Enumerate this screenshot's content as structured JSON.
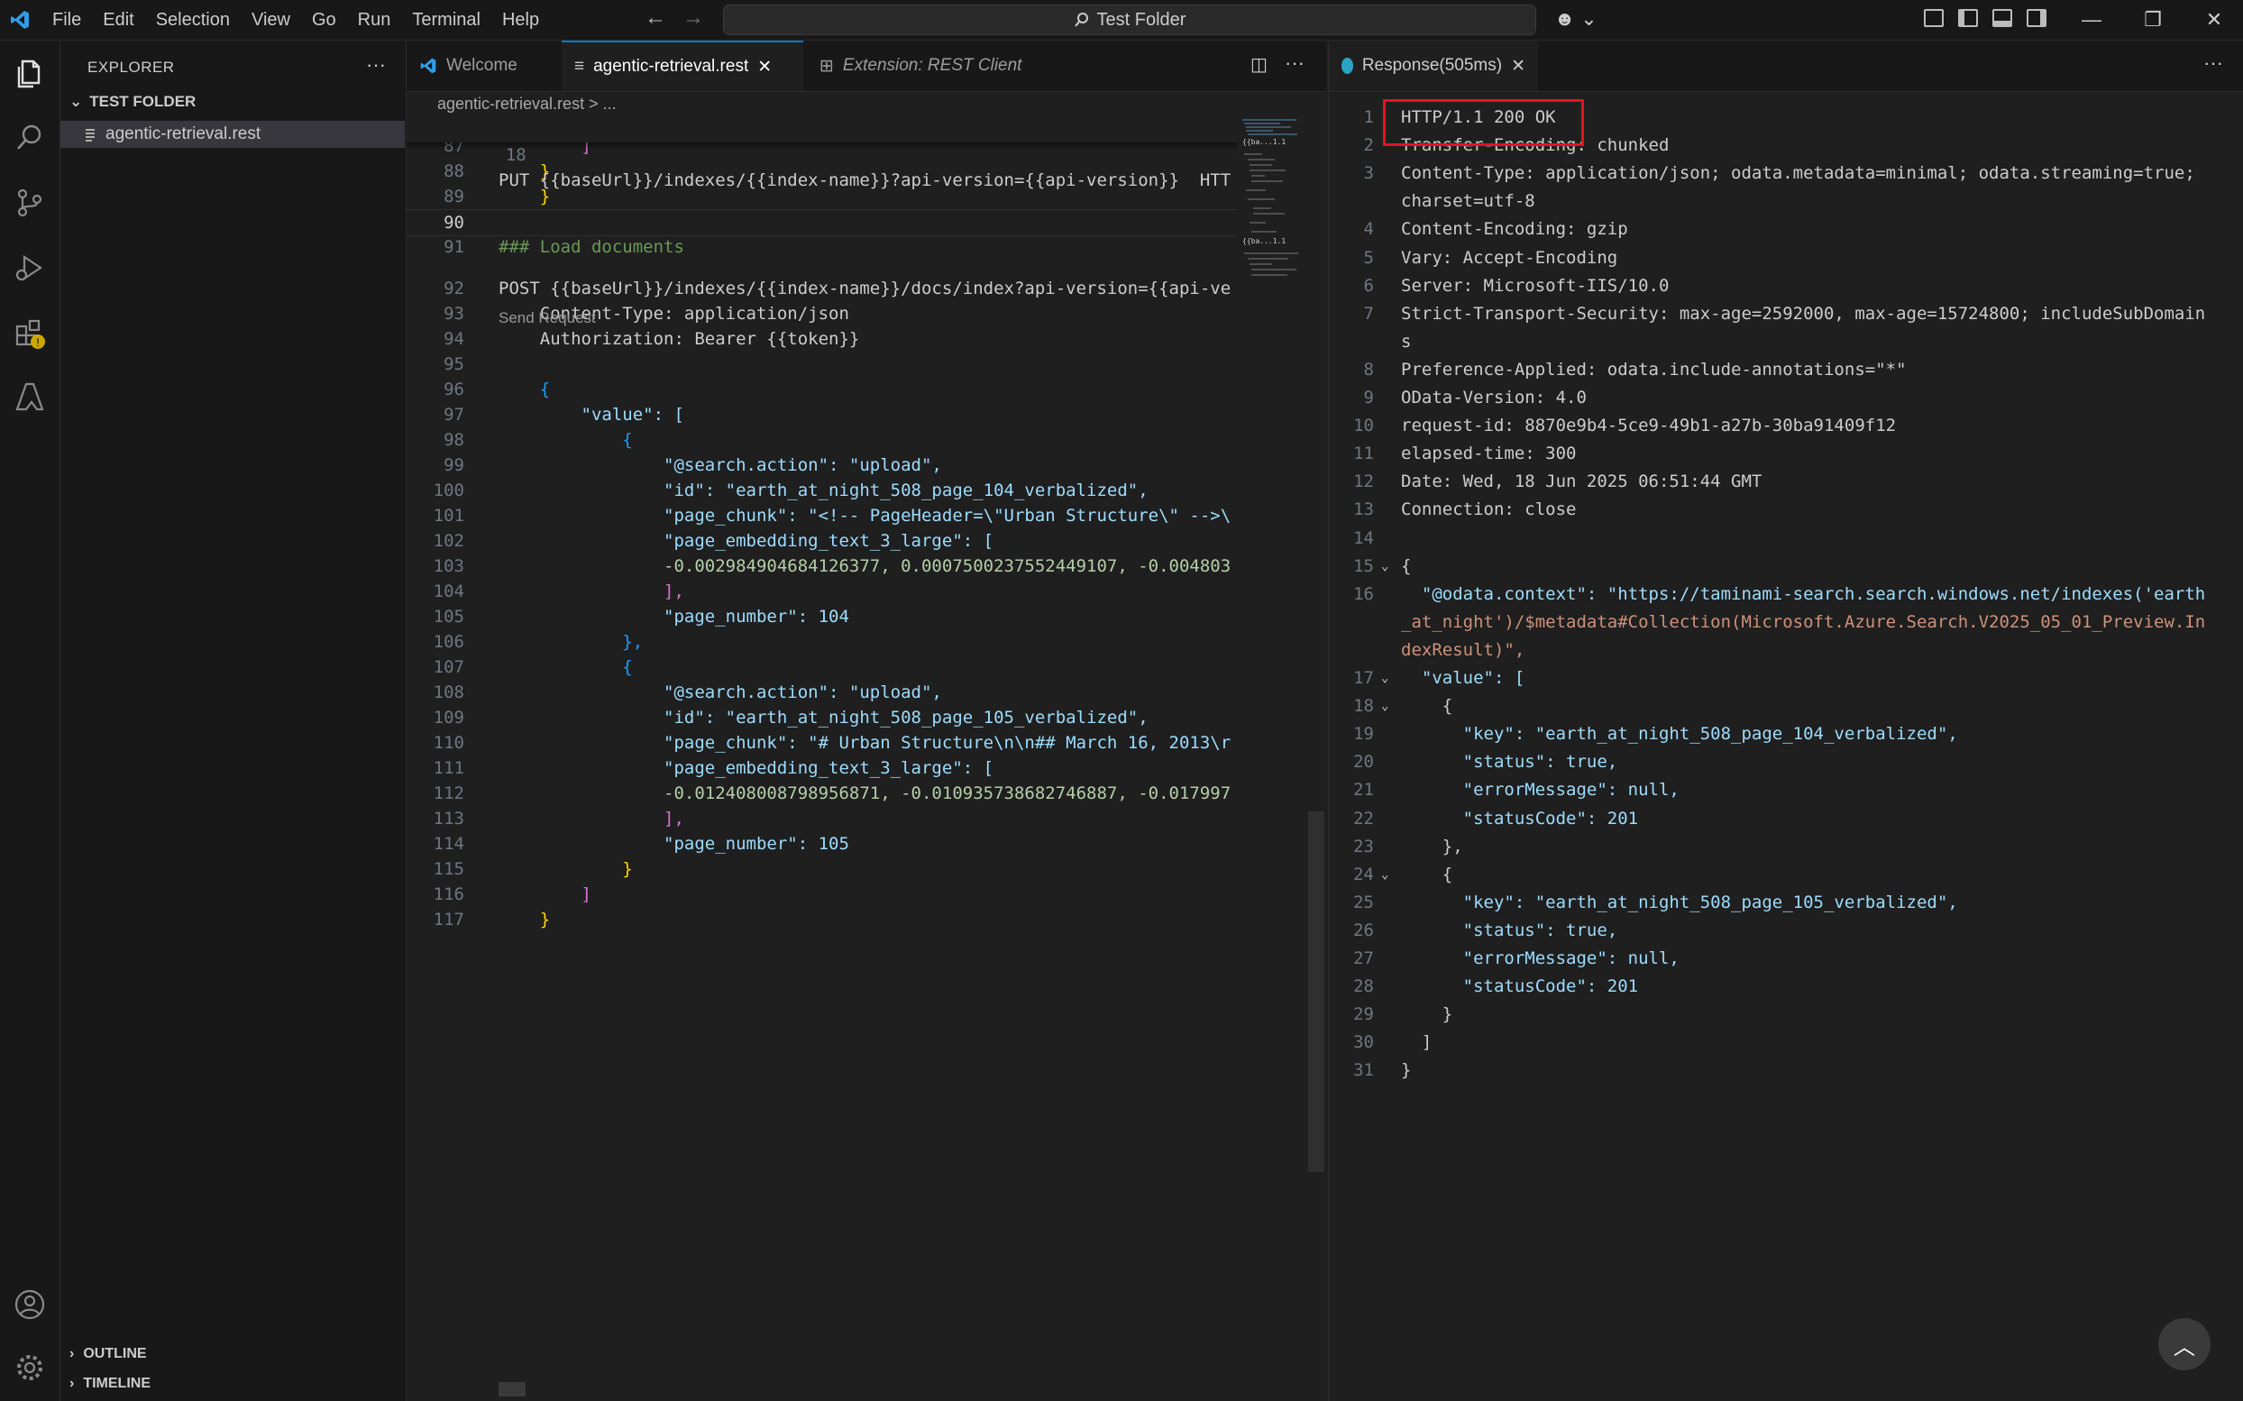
{
  "titlebar": {
    "menu": [
      "File",
      "Edit",
      "Selection",
      "View",
      "Go",
      "Run",
      "Terminal",
      "Help"
    ],
    "search_text": "Test Folder",
    "icons": [
      "back-arrow-icon",
      "forward-arrow-icon",
      "copilot-icon",
      "customize-layout-icon",
      "toggle-sidebar-icon",
      "toggle-panel-icon",
      "toggle-secondary-sidebar-icon",
      "minimize-icon",
      "restore-icon",
      "close-icon"
    ]
  },
  "activitybar": {
    "icons": [
      "explorer-icon",
      "search-icon",
      "source-control-icon",
      "run-debug-icon",
      "extensions-icon",
      "azure-icon",
      "accounts-icon",
      "manage-gear-icon"
    ]
  },
  "sidebar": {
    "title": "EXPLORER",
    "more": "···",
    "folder": "TEST FOLDER",
    "file": "agentic-retrieval.rest",
    "outline": "OUTLINE",
    "timeline": "TIMELINE"
  },
  "editor1": {
    "tabs": [
      {
        "label": "Welcome"
      },
      {
        "label": "agentic-retrieval.rest",
        "close": "✕"
      },
      {
        "label": "Extension: REST Client"
      }
    ],
    "breadcrumb": "agentic-retrieval.rest  >  ...",
    "sticky": {
      "num": "18",
      "text": "PUT {{baseUrl}}/indexes/{{index-name}}?api-version={{api-version}}  HTT"
    },
    "codelens": "Send Request",
    "lines": [
      {
        "num": "87",
        "text": "        ]"
      },
      {
        "num": "88",
        "text": "    }"
      },
      {
        "num": "89",
        "text": "    }"
      },
      {
        "num": "90",
        "text": ""
      },
      {
        "num": "91",
        "text": "### Load documents"
      },
      {
        "num": "92",
        "text": "POST {{baseUrl}}/indexes/{{index-name}}/docs/index?api-version={{api-ve"
      },
      {
        "num": "93",
        "text": "    Content-Type: application/json"
      },
      {
        "num": "94",
        "text": "    Authorization: Bearer {{token}}"
      },
      {
        "num": "95",
        "text": ""
      },
      {
        "num": "96",
        "text": "    {"
      },
      {
        "num": "97",
        "text": "        \"value\": ["
      },
      {
        "num": "98",
        "text": "            {"
      },
      {
        "num": "99",
        "text": "                \"@search.action\": \"upload\","
      },
      {
        "num": "100",
        "text": "                \"id\": \"earth_at_night_508_page_104_verbalized\","
      },
      {
        "num": "101",
        "text": "                \"page_chunk\": \"<!-- PageHeader=\\\"Urban Structure\\\" -->\\"
      },
      {
        "num": "102",
        "text": "                \"page_embedding_text_3_large\": ["
      },
      {
        "num": "103",
        "text": "                -0.002984904684126377, 0.0007500237552449107, -0.004803"
      },
      {
        "num": "104",
        "text": "                ],"
      },
      {
        "num": "105",
        "text": "                \"page_number\": 104"
      },
      {
        "num": "106",
        "text": "            },"
      },
      {
        "num": "107",
        "text": "            {"
      },
      {
        "num": "108",
        "text": "                \"@search.action\": \"upload\","
      },
      {
        "num": "109",
        "text": "                \"id\": \"earth_at_night_508_page_105_verbalized\","
      },
      {
        "num": "110",
        "text": "                \"page_chunk\": \"# Urban Structure\\n\\n## March 16, 2013\\r"
      },
      {
        "num": "111",
        "text": "                \"page_embedding_text_3_large\": ["
      },
      {
        "num": "112",
        "text": "                -0.012408008798956871, -0.010935738682746887, -0.017997"
      },
      {
        "num": "113",
        "text": "                ],"
      },
      {
        "num": "114",
        "text": "                \"page_number\": 105"
      },
      {
        "num": "115",
        "text": "            }"
      },
      {
        "num": "116",
        "text": "        ]"
      },
      {
        "num": "117",
        "text": "    }"
      }
    ]
  },
  "response": {
    "tab_label": "Response(505ms)",
    "tab_close": "✕",
    "more": "···",
    "scroll_top": "︿",
    "lines": [
      {
        "num": "1",
        "text": "HTTP/1.1 200 OK"
      },
      {
        "num": "2",
        "text": "Transfer-Encoding: chunked"
      },
      {
        "num": "3",
        "text": "Content-Type: application/json; odata.metadata=minimal; odata.streaming=true;"
      },
      {
        "num": "",
        "text": "charset=utf-8"
      },
      {
        "num": "4",
        "text": "Content-Encoding: gzip"
      },
      {
        "num": "5",
        "text": "Vary: Accept-Encoding"
      },
      {
        "num": "6",
        "text": "Server: Microsoft-IIS/10.0"
      },
      {
        "num": "7",
        "text": "Strict-Transport-Security: max-age=2592000, max-age=15724800; includeSubDomain"
      },
      {
        "num": "",
        "text": "s"
      },
      {
        "num": "8",
        "text": "Preference-Applied: odata.include-annotations=\"*\""
      },
      {
        "num": "9",
        "text": "OData-Version: 4.0"
      },
      {
        "num": "10",
        "text": "request-id: 8870e9b4-5ce9-49b1-a27b-30ba91409f12"
      },
      {
        "num": "11",
        "text": "elapsed-time: 300"
      },
      {
        "num": "12",
        "text": "Date: Wed, 18 Jun 2025 06:51:44 GMT"
      },
      {
        "num": "13",
        "text": "Connection: close"
      },
      {
        "num": "14",
        "text": ""
      },
      {
        "num": "15",
        "text": "{"
      },
      {
        "num": "16",
        "text": "  \"@odata.context\": \"https://taminami-search.search.windows.net/indexes('earth"
      },
      {
        "num": "",
        "text": "_at_night')/$metadata#Collection(Microsoft.Azure.Search.V2025_05_01_Preview.In"
      },
      {
        "num": "",
        "text": "dexResult)\","
      },
      {
        "num": "17",
        "text": "  \"value\": ["
      },
      {
        "num": "18",
        "text": "    {"
      },
      {
        "num": "19",
        "text": "      \"key\": \"earth_at_night_508_page_104_verbalized\","
      },
      {
        "num": "20",
        "text": "      \"status\": true,"
      },
      {
        "num": "21",
        "text": "      \"errorMessage\": null,"
      },
      {
        "num": "22",
        "text": "      \"statusCode\": 201"
      },
      {
        "num": "23",
        "text": "    },"
      },
      {
        "num": "24",
        "text": "    {"
      },
      {
        "num": "25",
        "text": "      \"key\": \"earth_at_night_508_page_105_verbalized\","
      },
      {
        "num": "26",
        "text": "      \"status\": true,"
      },
      {
        "num": "27",
        "text": "      \"errorMessage\": null,"
      },
      {
        "num": "28",
        "text": "      \"statusCode\": 201"
      },
      {
        "num": "29",
        "text": "    }"
      },
      {
        "num": "30",
        "text": "  ]"
      },
      {
        "num": "31",
        "text": "}"
      }
    ]
  },
  "colors": {
    "accent": "#0078d4",
    "highlight_box": "#e81123",
    "header_key": "#f44747",
    "string": "#ce9178",
    "property": "#9cdcfe",
    "number": "#b5cea8",
    "comment": "#6a9955"
  }
}
